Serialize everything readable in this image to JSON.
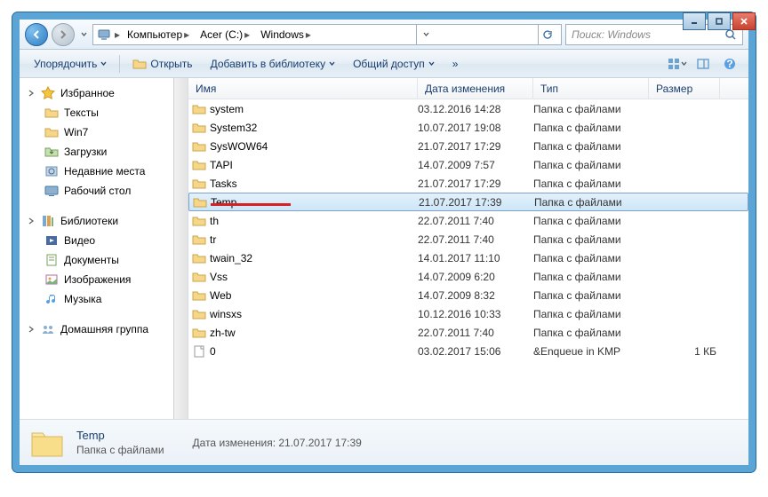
{
  "window": {
    "title": "Windows"
  },
  "nav": {
    "crumbs": [
      {
        "label": "Компьютер"
      },
      {
        "label": "Acer (C:)"
      },
      {
        "label": "Windows"
      }
    ],
    "search_placeholder": "Поиск: Windows"
  },
  "toolbar": {
    "organize": "Упорядочить",
    "open": "Открыть",
    "add_to_library": "Добавить в библиотеку",
    "share": "Общий доступ"
  },
  "sidebar": {
    "groups": [
      {
        "header": "Избранное",
        "icon": "star",
        "items": [
          {
            "label": "Тексты",
            "icon": "folder"
          },
          {
            "label": "Win7",
            "icon": "folder"
          },
          {
            "label": "Загрузки",
            "icon": "downloads"
          },
          {
            "label": "Недавние места",
            "icon": "recent"
          },
          {
            "label": "Рабочий стол",
            "icon": "desktop"
          }
        ]
      },
      {
        "header": "Библиотеки",
        "icon": "libraries",
        "items": [
          {
            "label": "Видео",
            "icon": "video"
          },
          {
            "label": "Документы",
            "icon": "document"
          },
          {
            "label": "Изображения",
            "icon": "image"
          },
          {
            "label": "Музыка",
            "icon": "music"
          }
        ]
      },
      {
        "header": "Домашняя группа",
        "icon": "homegroup",
        "items": []
      }
    ]
  },
  "columns": {
    "name": "Имя",
    "date": "Дата изменения",
    "type": "Тип",
    "size": "Размер"
  },
  "files": [
    {
      "name": "system",
      "date": "03.12.2016 14:28",
      "type": "Папка с файлами",
      "size": "",
      "icon": "folder"
    },
    {
      "name": "System32",
      "date": "10.07.2017 19:08",
      "type": "Папка с файлами",
      "size": "",
      "icon": "folder"
    },
    {
      "name": "SysWOW64",
      "date": "21.07.2017 17:29",
      "type": "Папка с файлами",
      "size": "",
      "icon": "folder"
    },
    {
      "name": "TAPI",
      "date": "14.07.2009 7:57",
      "type": "Папка с файлами",
      "size": "",
      "icon": "folder"
    },
    {
      "name": "Tasks",
      "date": "21.07.2017 17:29",
      "type": "Папка с файлами",
      "size": "",
      "icon": "folder"
    },
    {
      "name": "Temp",
      "date": "21.07.2017 17:39",
      "type": "Папка с файлами",
      "size": "",
      "icon": "folder",
      "selected": true,
      "highlighted": true
    },
    {
      "name": "th",
      "date": "22.07.2011 7:40",
      "type": "Папка с файлами",
      "size": "",
      "icon": "folder"
    },
    {
      "name": "tr",
      "date": "22.07.2011 7:40",
      "type": "Папка с файлами",
      "size": "",
      "icon": "folder"
    },
    {
      "name": "twain_32",
      "date": "14.01.2017 11:10",
      "type": "Папка с файлами",
      "size": "",
      "icon": "folder"
    },
    {
      "name": "Vss",
      "date": "14.07.2009 6:20",
      "type": "Папка с файлами",
      "size": "",
      "icon": "folder"
    },
    {
      "name": "Web",
      "date": "14.07.2009 8:32",
      "type": "Папка с файлами",
      "size": "",
      "icon": "folder"
    },
    {
      "name": "winsxs",
      "date": "10.12.2016 10:33",
      "type": "Папка с файлами",
      "size": "",
      "icon": "folder"
    },
    {
      "name": "zh-tw",
      "date": "22.07.2011 7:40",
      "type": "Папка с файлами",
      "size": "",
      "icon": "folder"
    },
    {
      "name": "0",
      "date": "03.02.2017 15:06",
      "type": "&Enqueue in KMP",
      "size": "1 КБ",
      "icon": "file"
    }
  ],
  "details": {
    "name": "Temp",
    "type": "Папка с файлами",
    "meta_label": "Дата изменения:",
    "meta_value": "21.07.2017 17:39"
  }
}
